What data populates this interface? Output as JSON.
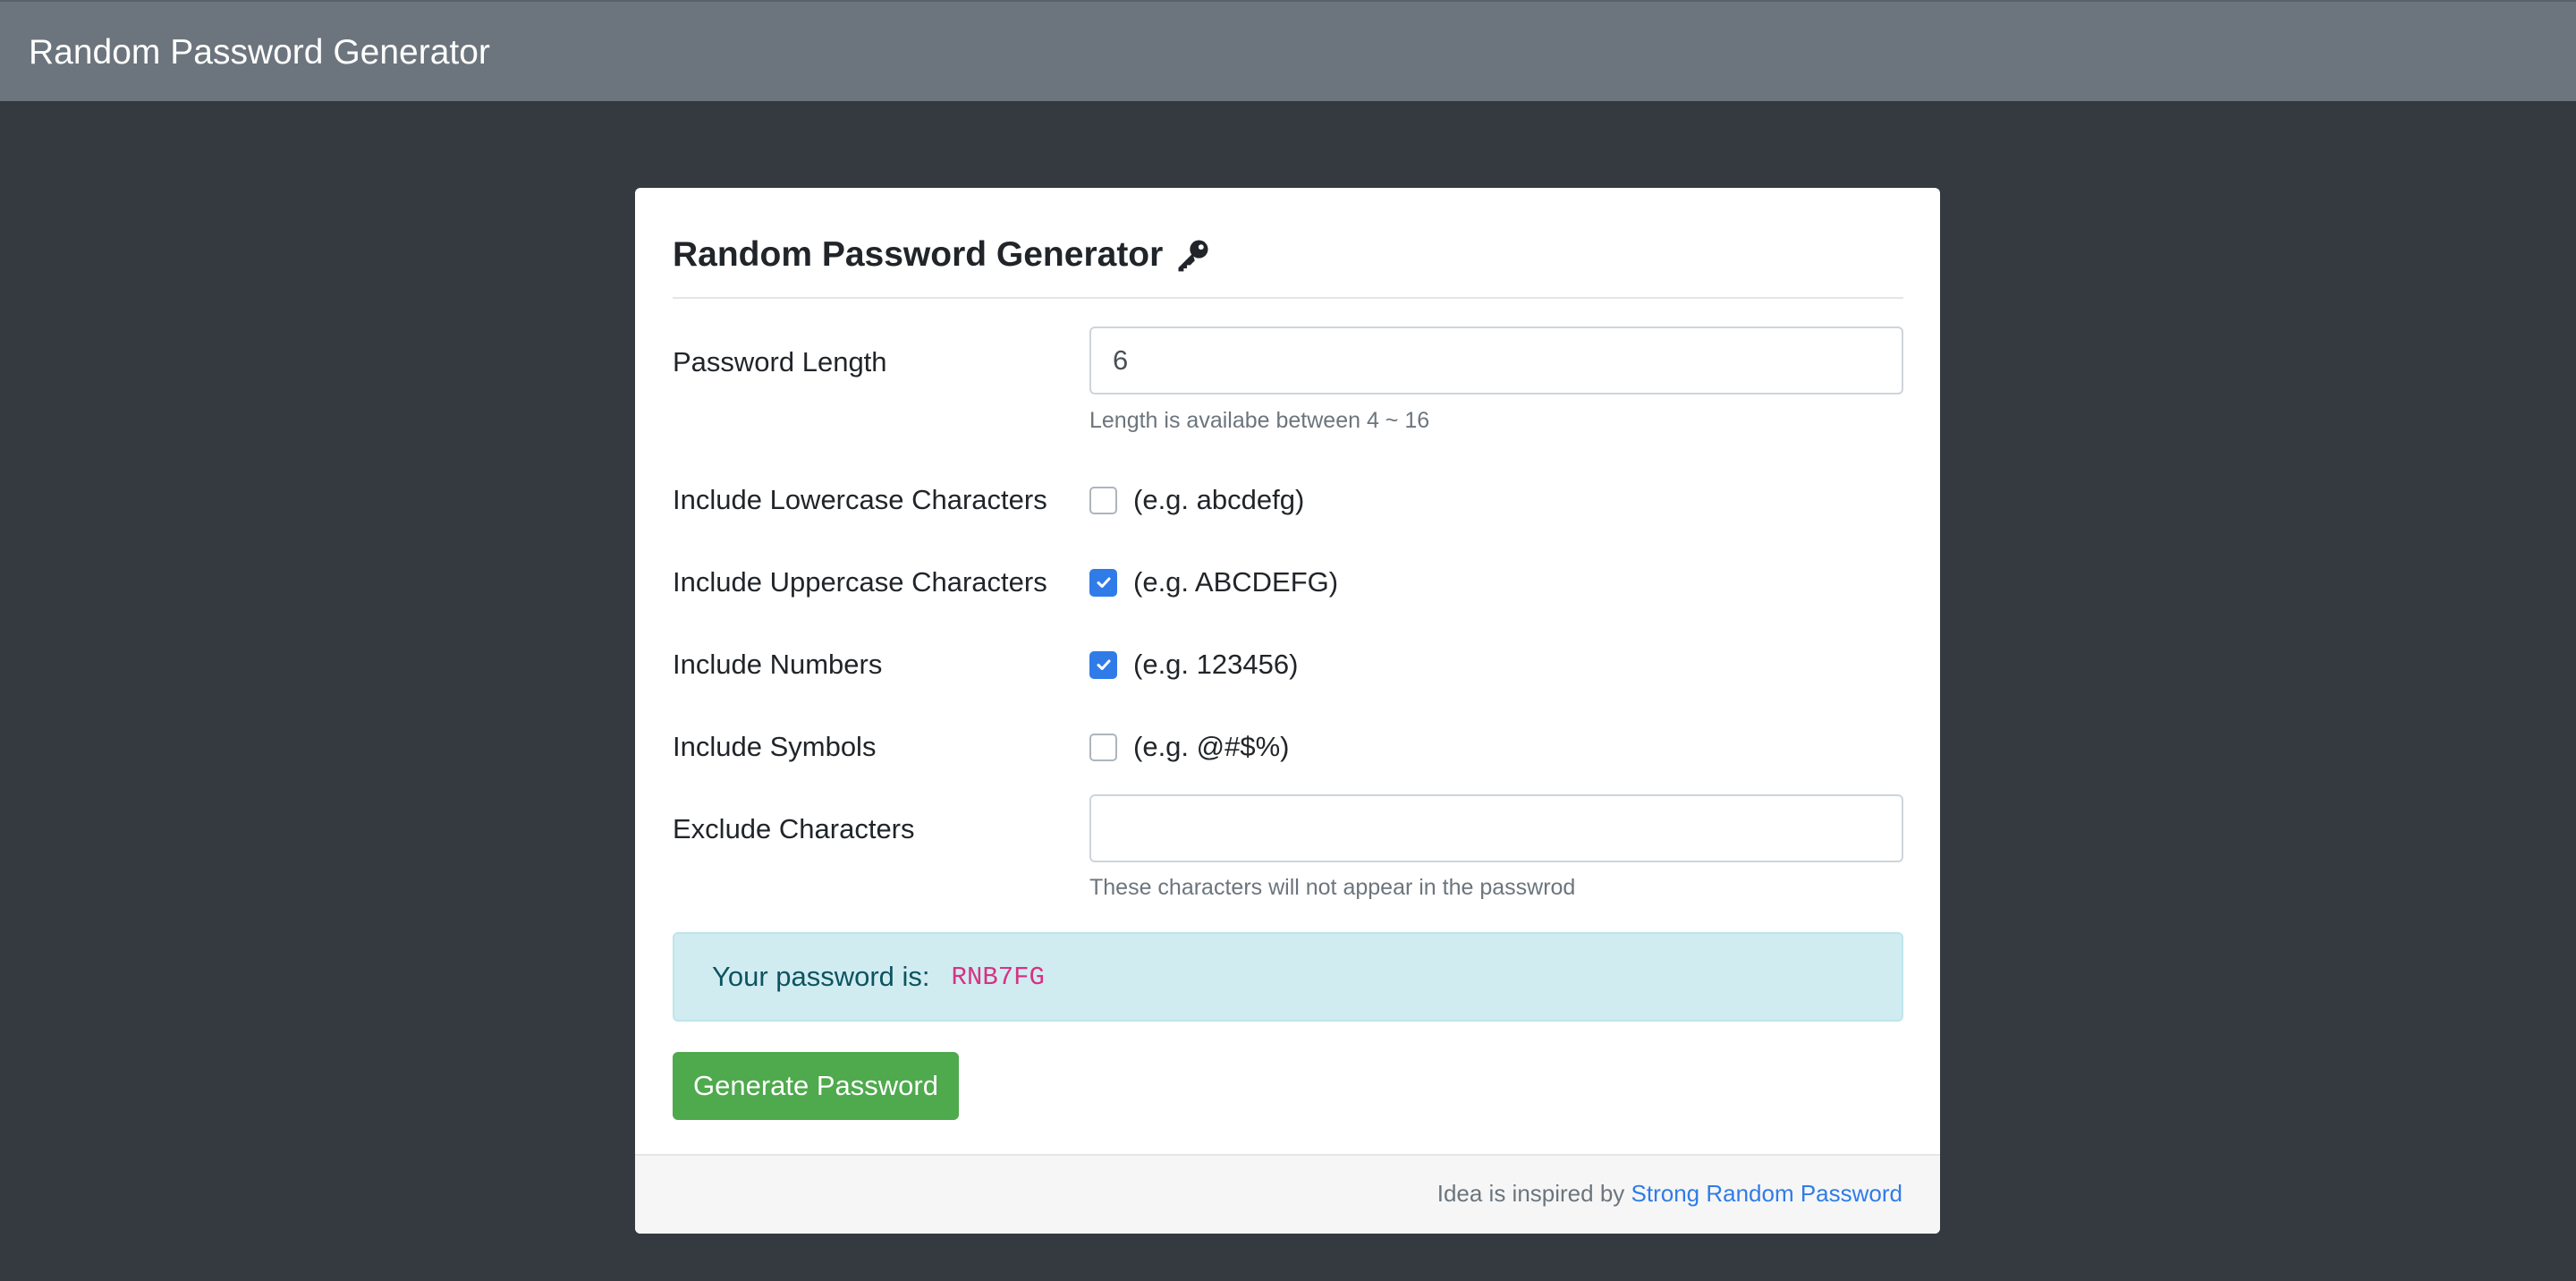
{
  "navbar": {
    "brand": "Random Password Generator"
  },
  "card": {
    "title": "Random Password Generator",
    "title_icon": "key-icon"
  },
  "form": {
    "length": {
      "label": "Password Length",
      "value": "6",
      "help": "Length is availabe between 4 ~ 16"
    },
    "lowercase": {
      "label": "Include Lowercase Characters",
      "example": "(e.g. abcdefg)",
      "checked": false
    },
    "uppercase": {
      "label": "Include Uppercase Characters",
      "example": "(e.g. ABCDEFG)",
      "checked": true
    },
    "numbers": {
      "label": "Include Numbers",
      "example": "(e.g. 123456)",
      "checked": true
    },
    "symbols": {
      "label": "Include Symbols",
      "example": "(e.g. @#$%)",
      "checked": false
    },
    "exclude": {
      "label": "Exclude Characters",
      "value": "",
      "help": "These characters will not appear in the passwrod"
    }
  },
  "result": {
    "label": "Your password is:",
    "password": "RNB7FG"
  },
  "generate_button": "Generate Password",
  "footer": {
    "text": "Idea is inspired by",
    "link_text": "Strong Random Password"
  },
  "colors": {
    "navbar": "#6c757d",
    "background": "#343a40",
    "checkbox_checked": "#2f7ce8",
    "button": "#4fa94d",
    "alert_bg": "#d1ecf1",
    "password_text": "#d63384"
  }
}
